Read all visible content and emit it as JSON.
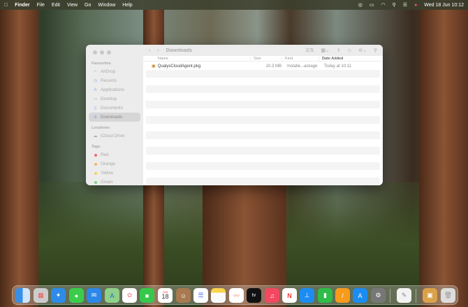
{
  "menubar": {
    "apple": "",
    "app": "Finder",
    "items": [
      "File",
      "Edit",
      "View",
      "Go",
      "Window",
      "Help"
    ],
    "clock": "Wed 18 Jun  10:12"
  },
  "finder": {
    "title": "Downloads",
    "sidebar": {
      "favourites_label": "Favourites",
      "favourites": [
        {
          "label": "AirDrop",
          "icon": "⌔"
        },
        {
          "label": "Recents",
          "icon": "◷"
        },
        {
          "label": "Applications",
          "icon": "A"
        },
        {
          "label": "Desktop",
          "icon": "▭"
        },
        {
          "label": "Documents",
          "icon": "▯"
        },
        {
          "label": "Downloads",
          "icon": "⊕"
        }
      ],
      "locations_label": "Locations",
      "locations": [
        {
          "label": "iCloud Drive",
          "icon": "☁"
        }
      ],
      "tags_label": "Tags",
      "tags": [
        {
          "label": "Red",
          "color": "#f26d6d"
        },
        {
          "label": "Orange",
          "color": "#f5b46b"
        },
        {
          "label": "Yellow",
          "color": "#f5cf5a"
        },
        {
          "label": "Green",
          "color": "#7fd67f"
        }
      ]
    },
    "columns": {
      "name": "Name",
      "size": "Size",
      "kind": "Kind",
      "date": "Date Added"
    },
    "files": [
      {
        "name": "QualysCloudAgent.pkg",
        "size": "10.3 MB",
        "kind": "Installe...ackage",
        "date": "Today at 10:11"
      }
    ]
  },
  "dock": {
    "calendar_month": "JUN",
    "calendar_day": "18",
    "tv": "tv"
  }
}
